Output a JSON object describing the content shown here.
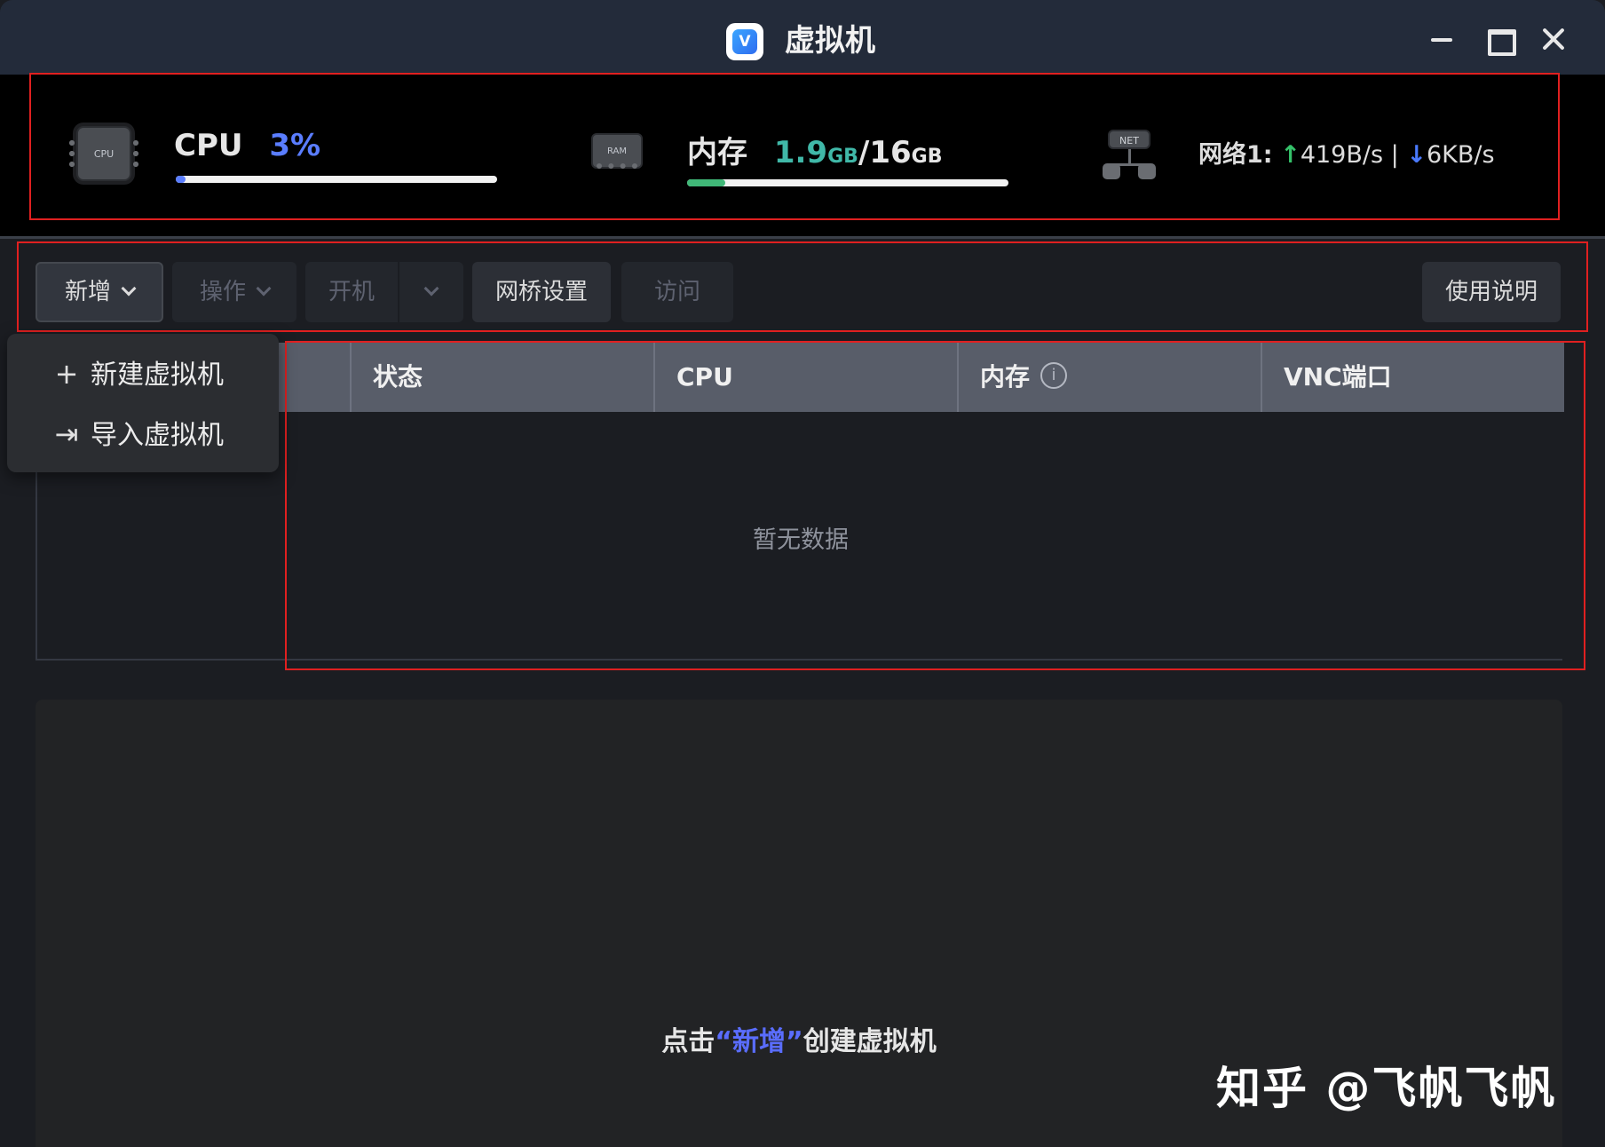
{
  "window": {
    "title": "虚拟机",
    "logo_letter": "V"
  },
  "stats": {
    "cpu": {
      "chip_text": "CPU",
      "label": "CPU",
      "value": "3%",
      "usage_fraction": 0.03
    },
    "memory": {
      "chip_text": "RAM",
      "label": "内存",
      "used": "1.9",
      "used_unit": "GB",
      "separator": "/",
      "total": "16",
      "total_unit": "GB",
      "usage_fraction": 0.12
    },
    "network": {
      "icon_text": "NET",
      "label": "网络1:",
      "up_arrow": "↑",
      "up": "419B/s",
      "divider": "|",
      "down_arrow": "↓",
      "down": "6KB/s"
    }
  },
  "toolbar": {
    "add": "新增",
    "operate": "操作",
    "power_on": "开机",
    "bridge_settings": "网桥设置",
    "visit": "访问",
    "help": "使用说明"
  },
  "dropdown": {
    "items": [
      {
        "icon": "+",
        "label": "新建虚拟机"
      },
      {
        "icon": "⇥",
        "label": "导入虚拟机"
      }
    ]
  },
  "table": {
    "columns": [
      "",
      "状态",
      "CPU",
      "内存",
      "VNC端口"
    ],
    "info_icon_glyph": "i",
    "empty_text": "暂无数据"
  },
  "bottom": {
    "hint_prefix": "点击",
    "hint_link": "“新增”",
    "hint_suffix": "创建虚拟机"
  },
  "watermark": "知乎 @飞帆飞帆",
  "colors": {
    "accent_blue": "#5a7dff",
    "memory_teal": "#40b8a8",
    "up_green": "#35c26a",
    "down_blue": "#4a7aff",
    "annotation_red": "#e02020"
  }
}
